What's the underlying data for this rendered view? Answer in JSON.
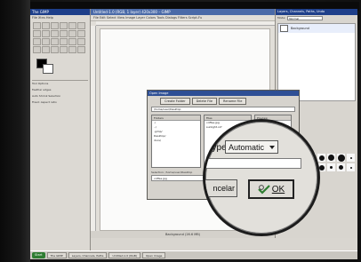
{
  "toolbox": {
    "title": "The GIMP",
    "menu": "File  Xtns  Help",
    "panel_title": "Tool Options",
    "options": [
      "Feather edges",
      "Auto Shrink Selection",
      "Fixed: Aspect ratio"
    ]
  },
  "image_window": {
    "title": "Untitled-1.0 (RGB, 1 layer) 420x300 – GIMP",
    "menu": "File  Edit  Select  View  Image  Layer  Colors  Tools  Dialogs  Filters  Script-Fu",
    "status": "Background (26.6 MB)"
  },
  "layers_dock": {
    "title": "Layers, Channels, Paths, Undo",
    "mode_label": "Mode:",
    "mode_value": "Normal",
    "layer_name": "Background"
  },
  "dialog": {
    "title": "Open Image",
    "buttons": [
      "Create Folder",
      "Delete File",
      "Rename File"
    ],
    "path": "/home/user/Desktop",
    "col_folders": "Folders",
    "col_files": "Files",
    "col_preview": "Preview",
    "folders": [
      "./",
      "../",
      ".gimp/",
      "Desktop/",
      "docs/"
    ],
    "files": [
      "coffee.jpg",
      "sunlight.xcf"
    ],
    "selection_label": "Selection: /home/user/Desktop",
    "selection_value": "coffee.jpg"
  },
  "magnifier": {
    "type_label": "Type:",
    "type_value": "Automatic",
    "cancel_label": "ncelar",
    "ok_label": "OK"
  },
  "taskbar": {
    "start": "Start",
    "tasks": [
      "The GIMP",
      "Layers, Channels, Paths",
      "Untitled-1.0 (RGB)",
      "Open Image"
    ]
  },
  "colors": {
    "title_bar": "#1e3f8a",
    "start_button": "#2e7d32"
  }
}
